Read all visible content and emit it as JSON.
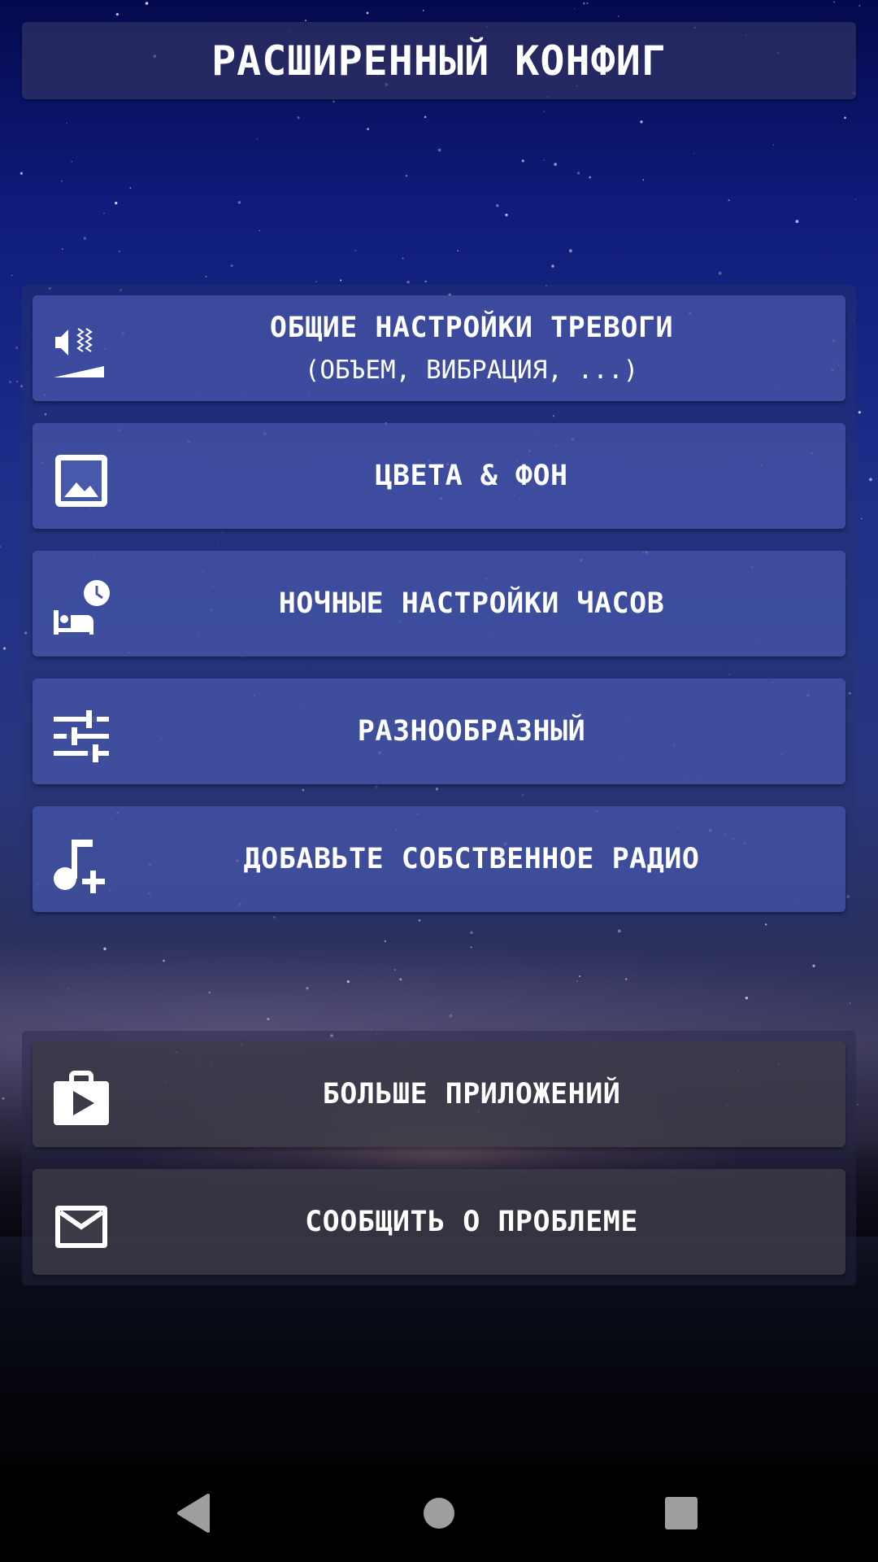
{
  "header": {
    "title": "РАСШИРЕННЫЙ КОНФИГ"
  },
  "main_menu": {
    "items": [
      {
        "icon": "volume-vibration-icon",
        "label": "ОБЩИЕ НАСТРОЙКИ ТРЕВОГИ",
        "sublabel": "(ОБЪЕМ, ВИБРАЦИЯ, ...)"
      },
      {
        "icon": "image-icon",
        "label": "ЦВЕТА & ФОН"
      },
      {
        "icon": "bed-clock-icon",
        "label": "НОЧНЫЕ НАСТРОЙКИ ЧАСОВ"
      },
      {
        "icon": "sliders-icon",
        "label": "РАЗНООБРАЗНЫЙ"
      },
      {
        "icon": "music-add-icon",
        "label": "ДОБАВЬТЕ СОБСТВЕННОЕ РАДИО"
      }
    ]
  },
  "extra_menu": {
    "items": [
      {
        "icon": "play-store-bag-icon",
        "label": "БОЛЬШЕ ПРИЛОЖЕНИЙ"
      },
      {
        "icon": "mail-icon",
        "label": "СООБЩИТЬ О ПРОБЛЕМЕ"
      }
    ]
  },
  "navbar": {
    "buttons": [
      "back-icon",
      "home-icon",
      "recents-icon"
    ],
    "color": "#9e9e9e"
  },
  "colors": {
    "item_background": "#4858aa",
    "text": "#ffffff"
  }
}
